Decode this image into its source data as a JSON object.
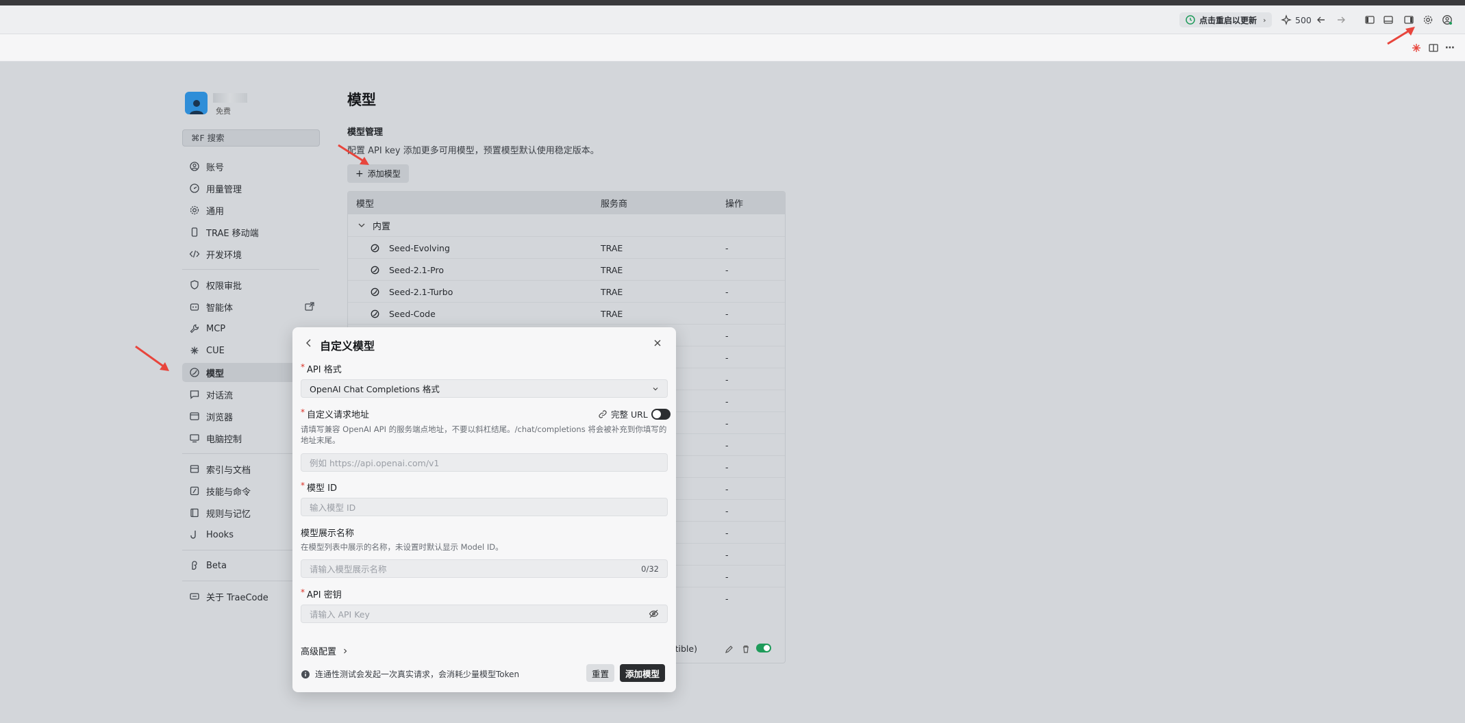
{
  "titlebar": {
    "restart_label": "点击重启以更新",
    "credits": "500"
  },
  "profile": {
    "plan": "免费"
  },
  "search": {
    "label": "⌘F 搜索"
  },
  "nav": {
    "group1": [
      "账号",
      "用量管理",
      "通用",
      "TRAE 移动端",
      "开发环境"
    ],
    "group2": [
      "权限审批",
      "智能体",
      "MCP",
      "CUE",
      "模型",
      "对话流",
      "浏览器",
      "电脑控制"
    ],
    "group3": [
      "索引与文档",
      "技能与命令",
      "规则与记忆",
      "Hooks"
    ],
    "group4": [
      "Beta"
    ],
    "group5": [
      "关于 TraeCode"
    ]
  },
  "main": {
    "title": "模型",
    "section_title": "模型管理",
    "description": "配置 API key 添加更多可用模型，预置模型默认使用稳定版本。",
    "add_button": "添加模型",
    "table": {
      "headers": [
        "模型",
        "服务商",
        "操作"
      ],
      "group_label": "内置",
      "rows": [
        {
          "name": "Seed-Evolving",
          "provider": "TRAE",
          "op": "-"
        },
        {
          "name": "Seed-2.1-Pro",
          "provider": "TRAE",
          "op": "-"
        },
        {
          "name": "Seed-2.1-Turbo",
          "provider": "TRAE",
          "op": "-"
        },
        {
          "name": "Seed-Code",
          "provider": "TRAE",
          "op": "-"
        },
        {
          "op": "-"
        },
        {
          "op": "-"
        },
        {
          "op": "-"
        },
        {
          "op": "-"
        },
        {
          "op": "-"
        },
        {
          "op": "-"
        },
        {
          "op": "-"
        },
        {
          "op": "-"
        },
        {
          "op": "-"
        },
        {
          "op": "-"
        },
        {
          "op": "-"
        },
        {
          "op": "-"
        },
        {
          "op": "-"
        }
      ],
      "custom_row_text": "patible)"
    }
  },
  "modal": {
    "title": "自定义模型",
    "api_format": {
      "label": "API 格式",
      "value": "OpenAI Chat Completions 格式"
    },
    "request_url": {
      "label": "自定义请求地址",
      "full_url_label": "完整 URL",
      "hint": "请填写兼容 OpenAI API 的服务端点地址，不要以斜杠结尾。/chat/completions 将会被补充到你填写的地址末尾。",
      "placeholder": "例如 https://api.openai.com/v1"
    },
    "model_id": {
      "label": "模型 ID",
      "placeholder": "输入模型 ID"
    },
    "display_name": {
      "label": "模型展示名称",
      "hint": "在模型列表中展示的名称，未设置时默认显示 Model ID。",
      "placeholder": "请输入模型展示名称",
      "counter": "0/32"
    },
    "api_key": {
      "label": "API 密钥",
      "placeholder": "请输入 API Key"
    },
    "advanced_label": "高级配置",
    "footnote": "连通性测试会发起一次真实请求，会消耗少量模型Token",
    "reset_button": "重置",
    "submit_button": "添加模型",
    "required_mark": "*"
  },
  "colors": {
    "accent_red": "#e8453c",
    "toggle_on": "#1e9b5a",
    "avatar_blue": "#2f8ed8"
  }
}
